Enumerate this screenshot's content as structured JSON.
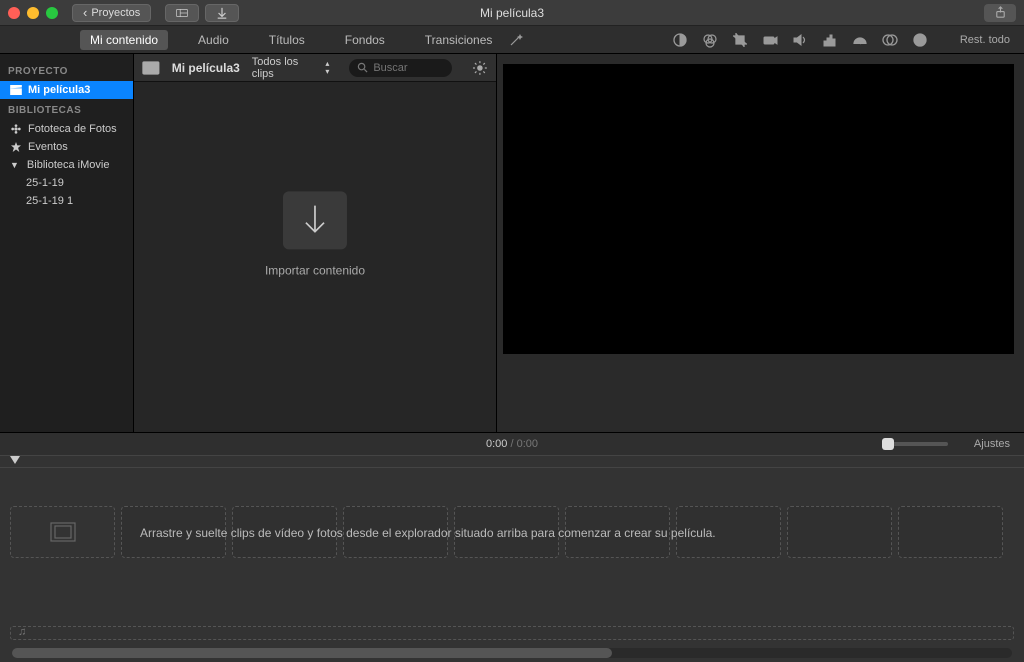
{
  "titlebar": {
    "projects_btn": "Proyectos",
    "back_chev": "‹",
    "title": "Mi película3"
  },
  "tabs": {
    "mycontent": "Mi contenido",
    "audio": "Audio",
    "titles": "Títulos",
    "backgrounds": "Fondos",
    "transitions": "Transiciones"
  },
  "panel": {
    "reset_all": "Rest. todo"
  },
  "sidebar": {
    "project_head": "PROYECTO",
    "project_name": "Mi película3",
    "lib_head": "BIBLIOTECAS",
    "foto_lib": "Fototeca de Fotos",
    "events": "Eventos",
    "imovie_lib": "Biblioteca iMovie",
    "sub1": "25-1-19",
    "sub2": "25-1-19 1"
  },
  "browser": {
    "event_name": "Mi película3",
    "clip_filter": "Todos los clips",
    "search_placeholder": "Buscar",
    "import_label": "Importar contenido"
  },
  "timebar": {
    "current": "0:00",
    "total": "0:00",
    "settings": "Ajustes"
  },
  "timeline": {
    "hint": "Arrastre y suelte clips de vídeo y fotos desde el explorador situado arriba para comenzar a crear su película."
  }
}
